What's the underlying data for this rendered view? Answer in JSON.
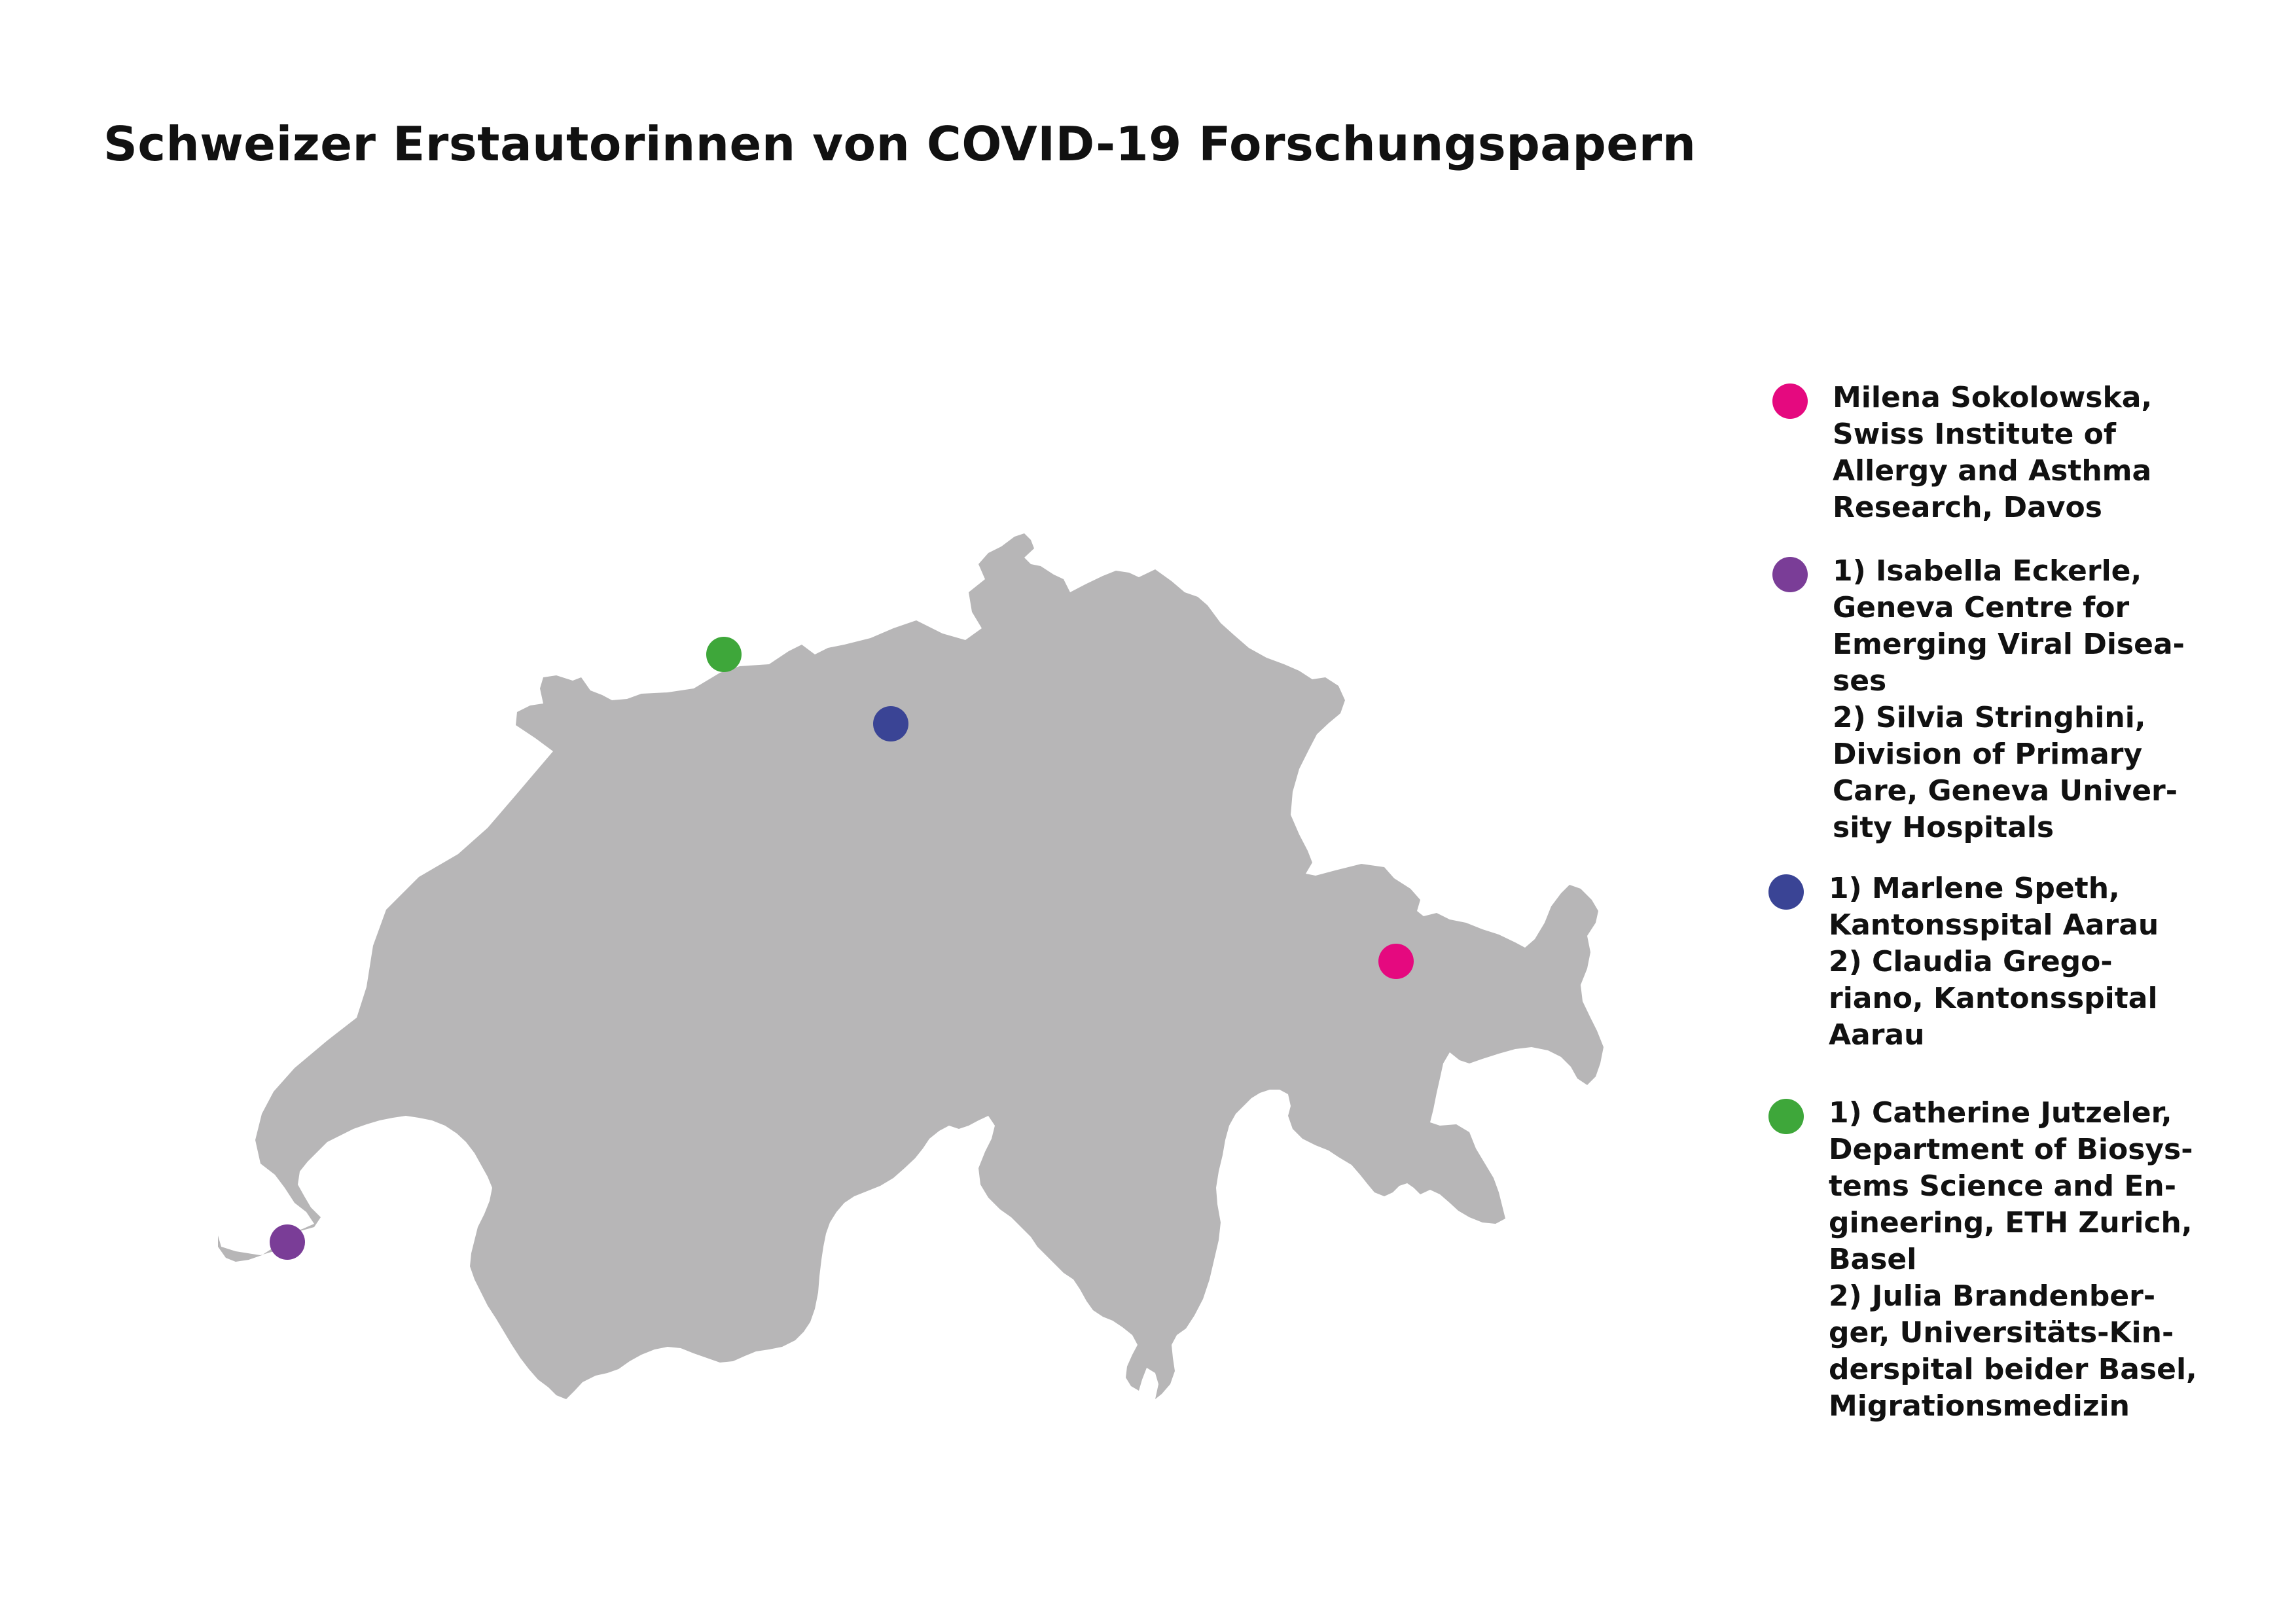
{
  "title": "Schweizer Erstautorinnen von COVID-19 Forschungspapern",
  "map": {
    "region_color": "#b7b6b7"
  },
  "markers": [
    {
      "id": "sokolowska",
      "place": "Davos",
      "color": "#e5097f"
    },
    {
      "id": "geneva",
      "place": "Geneva",
      "color": "#7a3d97"
    },
    {
      "id": "aarau",
      "place": "Aarau",
      "color": "#3a4495"
    },
    {
      "id": "basel",
      "place": "Basel",
      "color": "#3ea73a"
    }
  ],
  "legend": [
    {
      "color": "#e5097f",
      "lines": [
        "Milena Sokolowska,",
        "Swiss Institute of",
        "Allergy and Asthma",
        "Research, Davos"
      ]
    },
    {
      "color": "#7a3d97",
      "lines": [
        "1) Isabella Eckerle,",
        "Geneva Centre for",
        "Emerging Viral Disea-",
        "ses",
        "2) Silvia Stringhini,",
        "Division of Primary",
        "Care, Geneva Univer-",
        "sity Hospitals"
      ]
    },
    {
      "color": "#3a4495",
      "lines": [
        "1) Marlene Speth,",
        "Kantonsspital Aarau",
        "2) Claudia Grego-",
        "riano, Kantonsspital",
        "Aarau"
      ]
    },
    {
      "color": "#3ea73a",
      "lines": [
        "1) Catherine Jutzeler,",
        "Department of Biosys-",
        "tems Science and En-",
        "gineering, ETH Zurich,",
        "Basel",
        "2) Julia Brandenber-",
        "ger, Universitäts-Kin-",
        "derspital beider Basel,",
        "Migrationsmedizin"
      ]
    }
  ]
}
